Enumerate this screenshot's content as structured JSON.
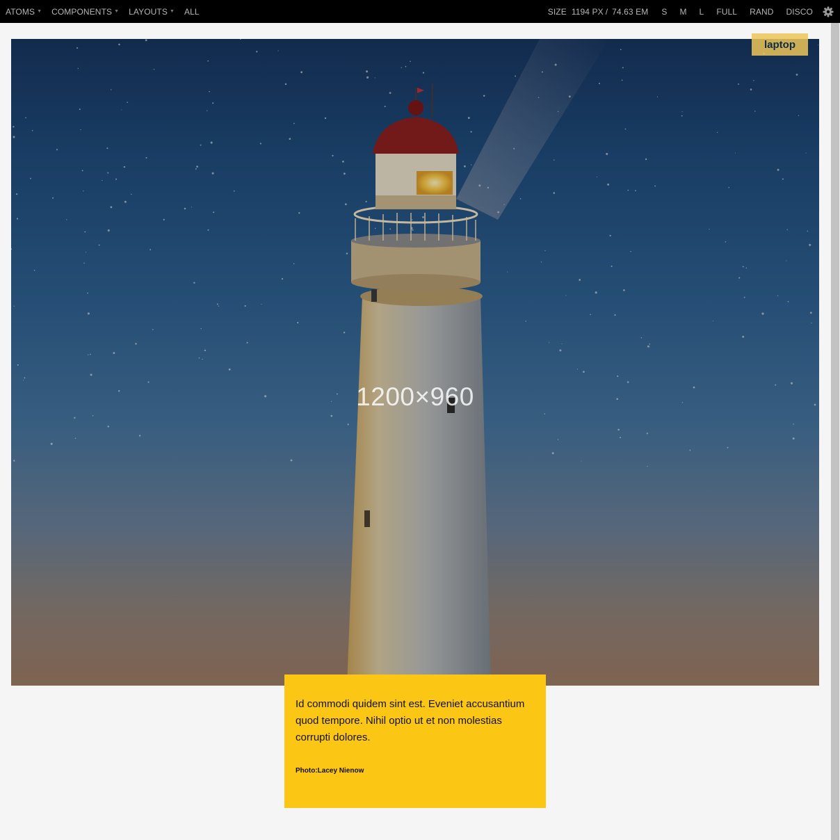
{
  "toolbar": {
    "nav": [
      {
        "label": "ATOMS",
        "caret": "▼"
      },
      {
        "label": "COMPONENTS",
        "caret": "▼"
      },
      {
        "label": "LAYOUTS",
        "caret": "▼"
      },
      {
        "label": "ALL"
      }
    ],
    "size": {
      "label": "SIZE",
      "px_value": "1194",
      "px_unit": "PX",
      "sep": "/",
      "em_value": "74.63",
      "em_unit": "EM"
    },
    "viewports": [
      "S",
      "M",
      "L",
      "FULL",
      "RAND",
      "DISCO"
    ],
    "settings_icon": "gear-icon"
  },
  "breakpoint_badge": "laptop",
  "hero": {
    "placeholder_label": "1200×960"
  },
  "caption": {
    "text": "Id commodi quidem sint est. Eveniet accusantium quod tempore. Nihil optio ut et non molestias corrupti dolores.",
    "credit": "Photo:Lacey Nienow"
  },
  "colors": {
    "toolbar_bg": "#000000",
    "caption_bg": "#fcc614",
    "badge_bg": "#ecc658",
    "page_bg": "#f5f5f5"
  }
}
